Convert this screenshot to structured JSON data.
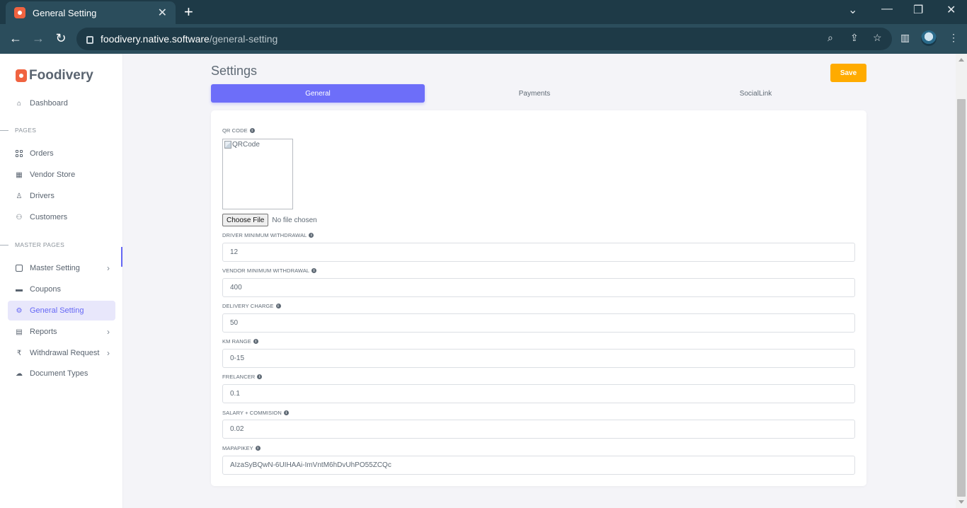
{
  "browser": {
    "tab_title": "General Setting",
    "tab_close": "✕",
    "new_tab": "+",
    "url_host": "foodivery.native.software",
    "url_path": "/general-setting"
  },
  "sidebar": {
    "brand": "Foodivery",
    "sections": {
      "pages": "PAGES",
      "master_pages": "MASTER PAGES"
    },
    "items": [
      {
        "label": "Dashboard",
        "icon": "home-icon"
      },
      {
        "label": "Orders",
        "icon": "grid-icon"
      },
      {
        "label": "Vendor Store",
        "icon": "table-icon"
      },
      {
        "label": "Drivers",
        "icon": "user-icon"
      },
      {
        "label": "Customers",
        "icon": "users-icon"
      },
      {
        "label": "Master Setting",
        "icon": "columns-icon"
      },
      {
        "label": "Coupons",
        "icon": "ticket-icon"
      },
      {
        "label": "General Setting",
        "icon": "gear-icon"
      },
      {
        "label": "Reports",
        "icon": "file-icon"
      },
      {
        "label": "Withdrawal Request",
        "icon": "rupee-icon"
      },
      {
        "label": "Document Types",
        "icon": "cloud-upload-icon"
      }
    ]
  },
  "main": {
    "title": "Settings",
    "save_label": "Save",
    "tabs": [
      "General",
      "Payments",
      "SocialLink"
    ],
    "qr": {
      "label": "QR CODE",
      "alt": "QRCode",
      "choose_file": "Choose File",
      "no_file": "No file chosen"
    },
    "fields": [
      {
        "label": "DRIVER MINIMUM WITHDRAWAL",
        "value": "12"
      },
      {
        "label": "VENDOR MINIMUM WITHDRAWAL",
        "value": "400"
      },
      {
        "label": "DELIVERY CHARGE",
        "value": "50"
      },
      {
        "label": "KM RANGE",
        "value": "0-15"
      },
      {
        "label": "FRELANCER",
        "value": "0.1"
      },
      {
        "label": "SALARY + COMMISION",
        "value": "0.02"
      },
      {
        "label": "MAPAPIKEY",
        "value": "AIzaSyBQwN-6UIHAAi-ImVntM6hDvUhPO55ZCQc"
      }
    ]
  },
  "colors": {
    "accent": "#6d6ef9",
    "save": "#ffab00",
    "brand": "#f06340"
  }
}
